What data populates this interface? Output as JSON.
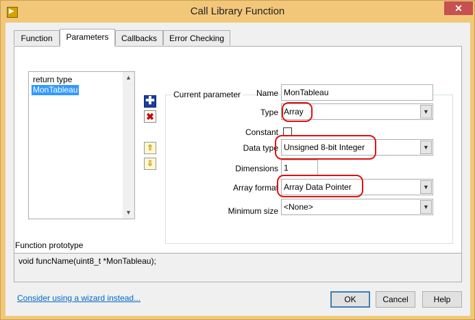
{
  "window": {
    "title": "Call Library Function"
  },
  "tabs": [
    {
      "label": "Function"
    },
    {
      "label": "Parameters"
    },
    {
      "label": "Callbacks"
    },
    {
      "label": "Error Checking"
    }
  ],
  "param_list": {
    "items": [
      "return type",
      "MonTableau"
    ],
    "selected": "MonTableau"
  },
  "side_buttons": {
    "add_icon": "plus-icon",
    "remove_icon": "x-icon",
    "up_icon": "arrow-up-icon",
    "down_icon": "arrow-down-icon"
  },
  "current_parameter": {
    "group_label": "Current parameter",
    "name_label": "Name",
    "name_value": "MonTableau",
    "type_label": "Type",
    "type_value": "Array",
    "constant_label": "Constant",
    "constant_checked": false,
    "data_type_label": "Data type",
    "data_type_value": "Unsigned 8-bit Integer",
    "dimensions_label": "Dimensions",
    "dimensions_value": "1",
    "array_format_label": "Array format",
    "array_format_value": "Array Data Pointer",
    "min_size_label": "Minimum size",
    "min_size_value": "<None>"
  },
  "prototype": {
    "label": "Function prototype",
    "text": "void  funcName(uint8_t *MonTableau);"
  },
  "footer": {
    "wizard_link": "Consider using a wizard instead...",
    "ok": "OK",
    "cancel": "Cancel",
    "help": "Help"
  },
  "colors": {
    "accent": "#3399ff",
    "highlight": "#e01010",
    "link": "#0066cc",
    "titlebar": "#f2c77a"
  }
}
